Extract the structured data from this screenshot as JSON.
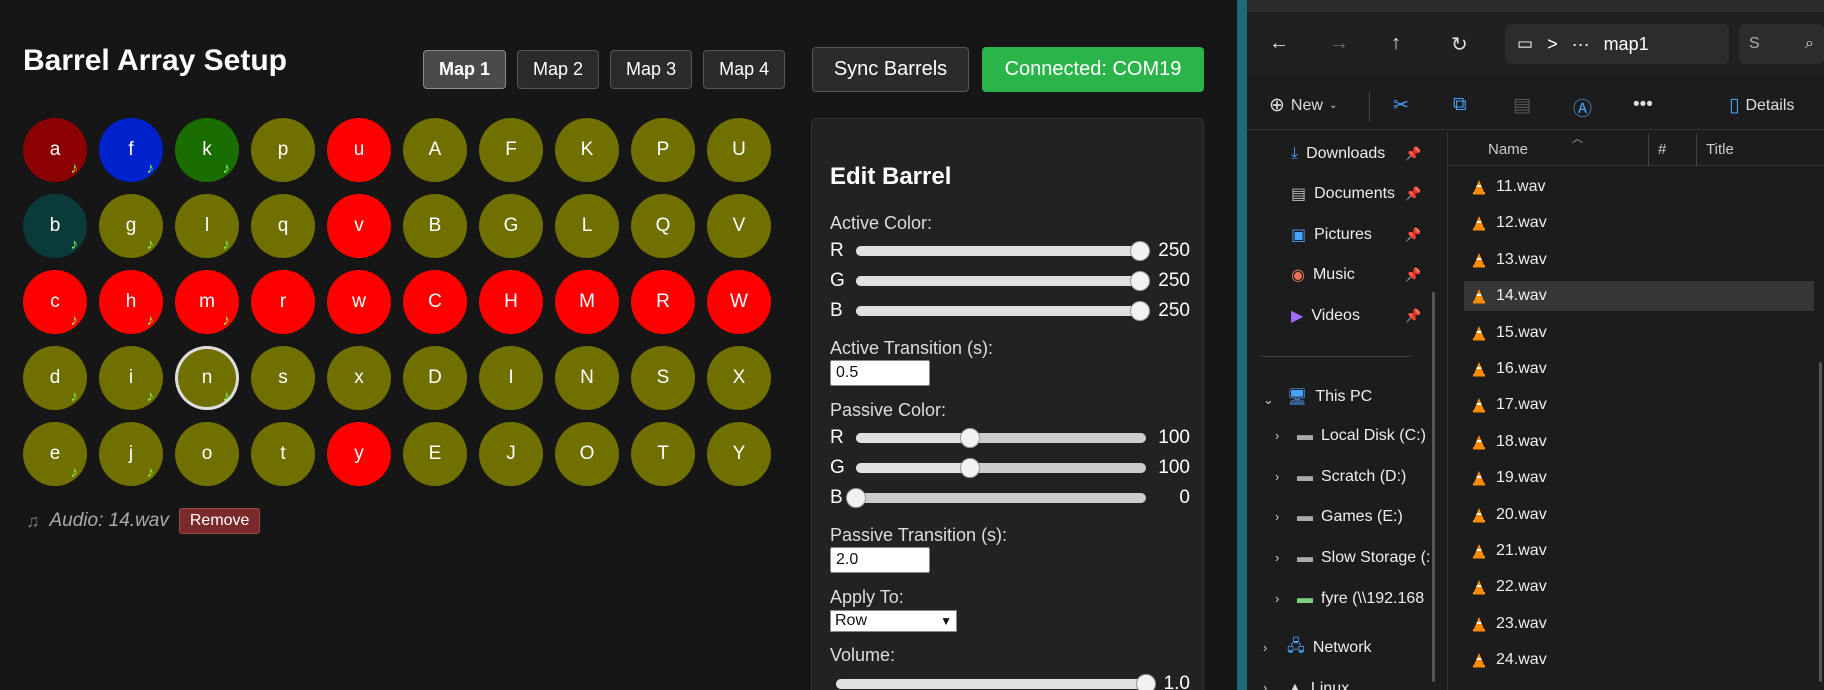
{
  "app": {
    "title": "Barrel Array Setup",
    "maps": [
      {
        "label": "Map 1",
        "active": true
      },
      {
        "label": "Map 2",
        "active": false
      },
      {
        "label": "Map 3",
        "active": false
      },
      {
        "label": "Map 4",
        "active": false
      }
    ],
    "sync_label": "Sync Barrels",
    "connection_status": "Connected: COM19",
    "colors": {
      "olive": "#707000",
      "red": "#ff0000",
      "darkred": "#8b0000",
      "blue": "#0022cc",
      "green": "#1a6e00",
      "teal": "#0b3a3a",
      "connected": "#2ab44a",
      "note": "#7cff4a"
    },
    "grid_rows": [
      [
        {
          "label": "a",
          "color": "#8b0000",
          "audio": true
        },
        {
          "label": "f",
          "color": "#0022cc",
          "audio": true
        },
        {
          "label": "k",
          "color": "#1a6e00",
          "audio": true
        },
        {
          "label": "p",
          "color": "#707000",
          "audio": false
        },
        {
          "label": "u",
          "color": "#ff0000",
          "audio": false
        },
        {
          "label": "A",
          "color": "#707000",
          "audio": false
        },
        {
          "label": "F",
          "color": "#707000",
          "audio": false
        },
        {
          "label": "K",
          "color": "#707000",
          "audio": false
        },
        {
          "label": "P",
          "color": "#707000",
          "audio": false
        },
        {
          "label": "U",
          "color": "#707000",
          "audio": false
        }
      ],
      [
        {
          "label": "b",
          "color": "#0b3a3a",
          "audio": true
        },
        {
          "label": "g",
          "color": "#707000",
          "audio": true
        },
        {
          "label": "l",
          "color": "#707000",
          "audio": true
        },
        {
          "label": "q",
          "color": "#707000",
          "audio": false
        },
        {
          "label": "v",
          "color": "#ff0000",
          "audio": false
        },
        {
          "label": "B",
          "color": "#707000",
          "audio": false
        },
        {
          "label": "G",
          "color": "#707000",
          "audio": false
        },
        {
          "label": "L",
          "color": "#707000",
          "audio": false
        },
        {
          "label": "Q",
          "color": "#707000",
          "audio": false
        },
        {
          "label": "V",
          "color": "#707000",
          "audio": false
        }
      ],
      [
        {
          "label": "c",
          "color": "#ff0000",
          "audio": true
        },
        {
          "label": "h",
          "color": "#ff0000",
          "audio": true
        },
        {
          "label": "m",
          "color": "#ff0000",
          "audio": true
        },
        {
          "label": "r",
          "color": "#ff0000",
          "audio": false
        },
        {
          "label": "w",
          "color": "#ff0000",
          "audio": false
        },
        {
          "label": "C",
          "color": "#ff0000",
          "audio": false
        },
        {
          "label": "H",
          "color": "#ff0000",
          "audio": false
        },
        {
          "label": "M",
          "color": "#ff0000",
          "audio": false
        },
        {
          "label": "R",
          "color": "#ff0000",
          "audio": false
        },
        {
          "label": "W",
          "color": "#ff0000",
          "audio": false
        }
      ],
      [
        {
          "label": "d",
          "color": "#707000",
          "audio": true
        },
        {
          "label": "i",
          "color": "#707000",
          "audio": true
        },
        {
          "label": "n",
          "color": "#707000",
          "audio": true,
          "selected": true
        },
        {
          "label": "s",
          "color": "#707000",
          "audio": false
        },
        {
          "label": "x",
          "color": "#707000",
          "audio": false
        },
        {
          "label": "D",
          "color": "#707000",
          "audio": false
        },
        {
          "label": "I",
          "color": "#707000",
          "audio": false
        },
        {
          "label": "N",
          "color": "#707000",
          "audio": false
        },
        {
          "label": "S",
          "color": "#707000",
          "audio": false
        },
        {
          "label": "X",
          "color": "#707000",
          "audio": false
        }
      ],
      [
        {
          "label": "e",
          "color": "#707000",
          "audio": true
        },
        {
          "label": "j",
          "color": "#707000",
          "audio": true
        },
        {
          "label": "o",
          "color": "#707000",
          "audio": false
        },
        {
          "label": "t",
          "color": "#707000",
          "audio": false
        },
        {
          "label": "y",
          "color": "#ff0000",
          "audio": false
        },
        {
          "label": "E",
          "color": "#707000",
          "audio": false
        },
        {
          "label": "J",
          "color": "#707000",
          "audio": false
        },
        {
          "label": "O",
          "color": "#707000",
          "audio": false
        },
        {
          "label": "T",
          "color": "#707000",
          "audio": false
        },
        {
          "label": "Y",
          "color": "#707000",
          "audio": false
        }
      ]
    ],
    "audio": {
      "icon": "music-note-icon",
      "label": "Audio: 14.wav",
      "remove_label": "Remove"
    },
    "edit": {
      "title": "Edit Barrel",
      "active_color_label": "Active Color:",
      "active_color": {
        "r": 250,
        "g": 250,
        "b": 250,
        "max": 255
      },
      "active_transition_label": "Active Transition (s):",
      "active_transition_value": "0.5",
      "passive_color_label": "Passive Color:",
      "passive_color": {
        "r": 100,
        "g": 100,
        "b": 0,
        "max": 255
      },
      "passive_transition_label": "Passive Transition (s):",
      "passive_transition_value": "2.0",
      "apply_to_label": "Apply To:",
      "apply_to_value": "Row",
      "volume_label": "Volume:",
      "volume_value": "1.0",
      "volume_fraction": 1.0,
      "channel_labels": {
        "r": "R",
        "g": "G",
        "b": "B"
      }
    }
  },
  "explorer": {
    "nav_icons": [
      "back-icon",
      "forward-icon",
      "up-icon",
      "refresh-icon",
      "monitor-icon"
    ],
    "breadcrumb": ">",
    "ellipsis": "···",
    "path": "map1",
    "search_placeholder": "S",
    "toolbar": {
      "new_label": "New",
      "details_label": "Details",
      "more_label": "•••"
    },
    "quick_access": [
      {
        "label": "Downloads",
        "icon": "download-icon"
      },
      {
        "label": "Documents",
        "icon": "document-icon"
      },
      {
        "label": "Pictures",
        "icon": "picture-icon"
      },
      {
        "label": "Music",
        "icon": "music-icon"
      },
      {
        "label": "Videos",
        "icon": "video-icon"
      }
    ],
    "this_pc_label": "This PC",
    "drives": [
      {
        "label": "Local Disk (C:)"
      },
      {
        "label": "Scratch (D:)"
      },
      {
        "label": "Games (E:)"
      },
      {
        "label": "Slow Storage (:"
      },
      {
        "label": "fyre (\\\\192.168"
      }
    ],
    "network_label": "Network",
    "linux_label": "Linux",
    "columns": {
      "name": "Name",
      "number": "#",
      "title": "Title"
    },
    "files": [
      {
        "name": "11.wav"
      },
      {
        "name": "12.wav"
      },
      {
        "name": "13.wav"
      },
      {
        "name": "14.wav",
        "selected": true
      },
      {
        "name": "15.wav"
      },
      {
        "name": "16.wav"
      },
      {
        "name": "17.wav"
      },
      {
        "name": "18.wav"
      },
      {
        "name": "19.wav"
      },
      {
        "name": "20.wav"
      },
      {
        "name": "21.wav"
      },
      {
        "name": "22.wav"
      },
      {
        "name": "23.wav"
      },
      {
        "name": "24.wav"
      }
    ]
  }
}
